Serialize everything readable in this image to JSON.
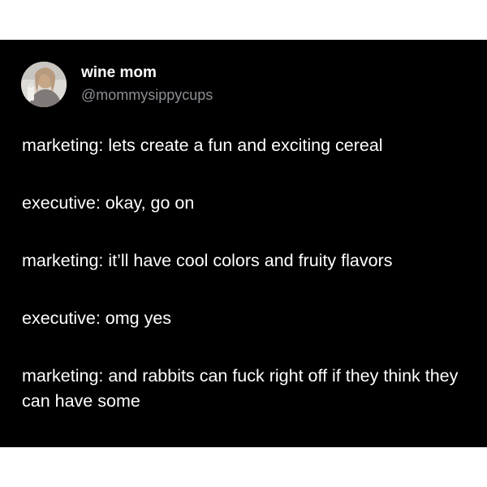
{
  "author": {
    "display_name": "wine mom",
    "handle": "@mommysippycups",
    "avatar_icon": "profile-photo"
  },
  "tweet": {
    "lines": [
      "marketing: lets create a fun and exciting cereal",
      "executive: okay, go on",
      "marketing: it’ll have cool colors and fruity flavors",
      "executive: omg yes",
      "marketing: and rabbits can fuck right off if they think they can have some"
    ]
  },
  "colors": {
    "background": "#000000",
    "text": "#ffffff",
    "handle": "#8b8f94",
    "page": "#ffffff"
  }
}
